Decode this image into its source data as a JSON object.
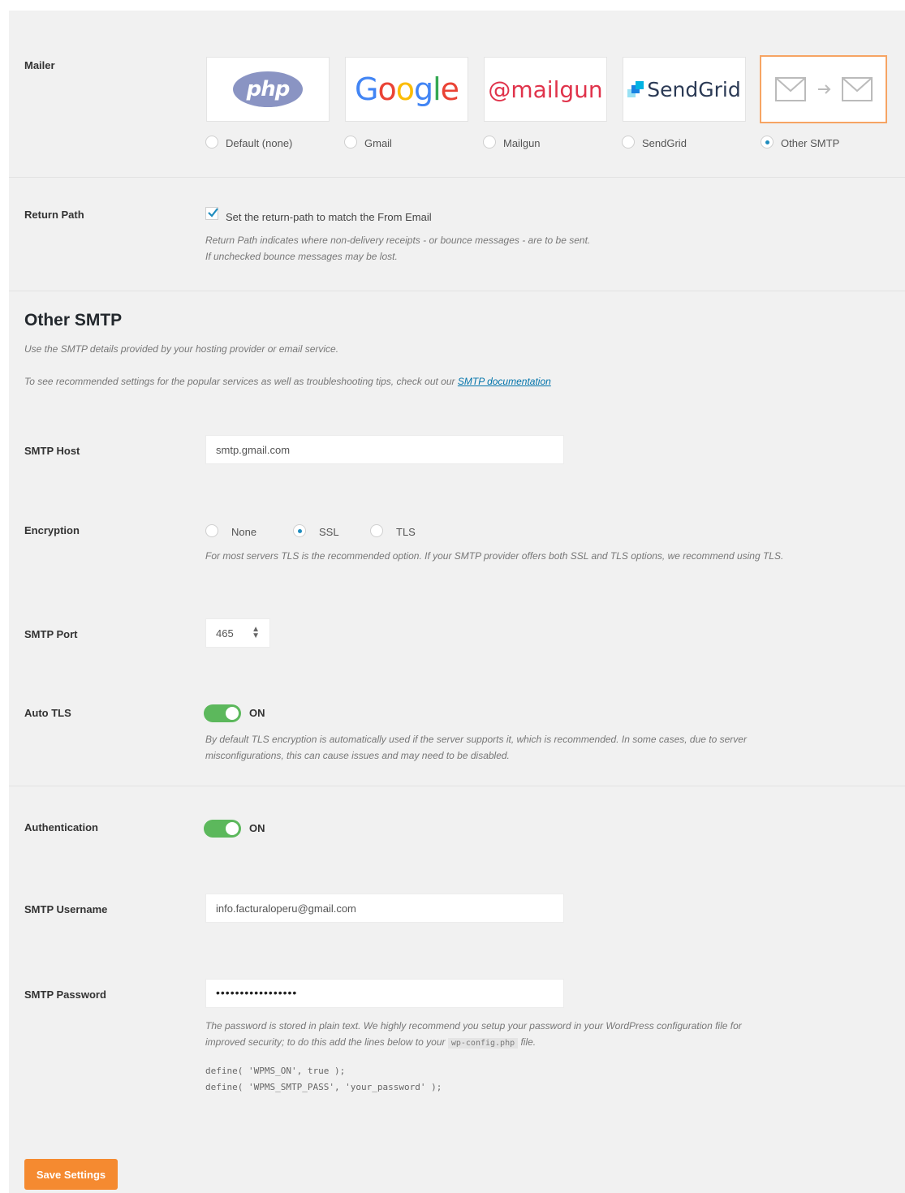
{
  "mailer": {
    "label": "Mailer",
    "options": [
      {
        "label": "Default (none)",
        "logo": "php",
        "selected": false
      },
      {
        "label": "Gmail",
        "logo": "Google",
        "selected": false
      },
      {
        "label": "Mailgun",
        "logo": "mailgun",
        "selected": false
      },
      {
        "label": "SendGrid",
        "logo": "SendGrid",
        "selected": false
      },
      {
        "label": "Other SMTP",
        "logo": "envelope-arrow-envelope",
        "selected": true
      }
    ]
  },
  "return_path": {
    "label": "Return Path",
    "checkbox_label": "Set the return-path to match the From Email",
    "checked": true,
    "desc_line1": "Return Path indicates where non-delivery receipts - or bounce messages - are to be sent.",
    "desc_line2": "If unchecked bounce messages may be lost."
  },
  "section": {
    "title": "Other SMTP",
    "subtitle": "Use the SMTP details provided by your hosting provider or email service.",
    "doc_text": "To see recommended settings for the popular services as well as troubleshooting tips, check out our",
    "doc_link": "SMTP documentation"
  },
  "smtp_host": {
    "label": "SMTP Host",
    "value": "smtp.gmail.com"
  },
  "encryption": {
    "label": "Encryption",
    "options": [
      {
        "label": "None",
        "selected": false
      },
      {
        "label": "SSL",
        "selected": true
      },
      {
        "label": "TLS",
        "selected": false
      }
    ],
    "desc": "For most servers TLS is the recommended option. If your SMTP provider offers both SSL and TLS options, we recommend using TLS."
  },
  "smtp_port": {
    "label": "SMTP Port",
    "value": "465"
  },
  "auto_tls": {
    "label": "Auto TLS",
    "state": "ON",
    "desc_line1": "By default TLS encryption is automatically used if the server supports it, which is recommended. In some cases, due to server",
    "desc_line2": "misconfigurations, this can cause issues and may need to be disabled."
  },
  "authentication": {
    "label": "Authentication",
    "state": "ON"
  },
  "smtp_username": {
    "label": "SMTP Username",
    "value": "info.facturaloperu@gmail.com"
  },
  "smtp_password": {
    "label": "SMTP Password",
    "value": "•••••••••••••••••",
    "desc_line1": "The password is stored in plain text. We highly recommend you setup your password in your WordPress configuration file for",
    "desc_line2_pre": "improved security; to do this add the lines below to your",
    "desc_code": "wp-config.php",
    "desc_line2_post": "file.",
    "code_line1": "define( 'WPMS_ON', true );",
    "code_line2": "define( 'WPMS_SMTP_PASS', 'your_password' );"
  },
  "save_button": "Save Settings",
  "colors": {
    "accent": "#f58a30",
    "toggle_on": "#5cb85c",
    "link": "#0073aa",
    "selected_tile_border": "#f6a463"
  }
}
